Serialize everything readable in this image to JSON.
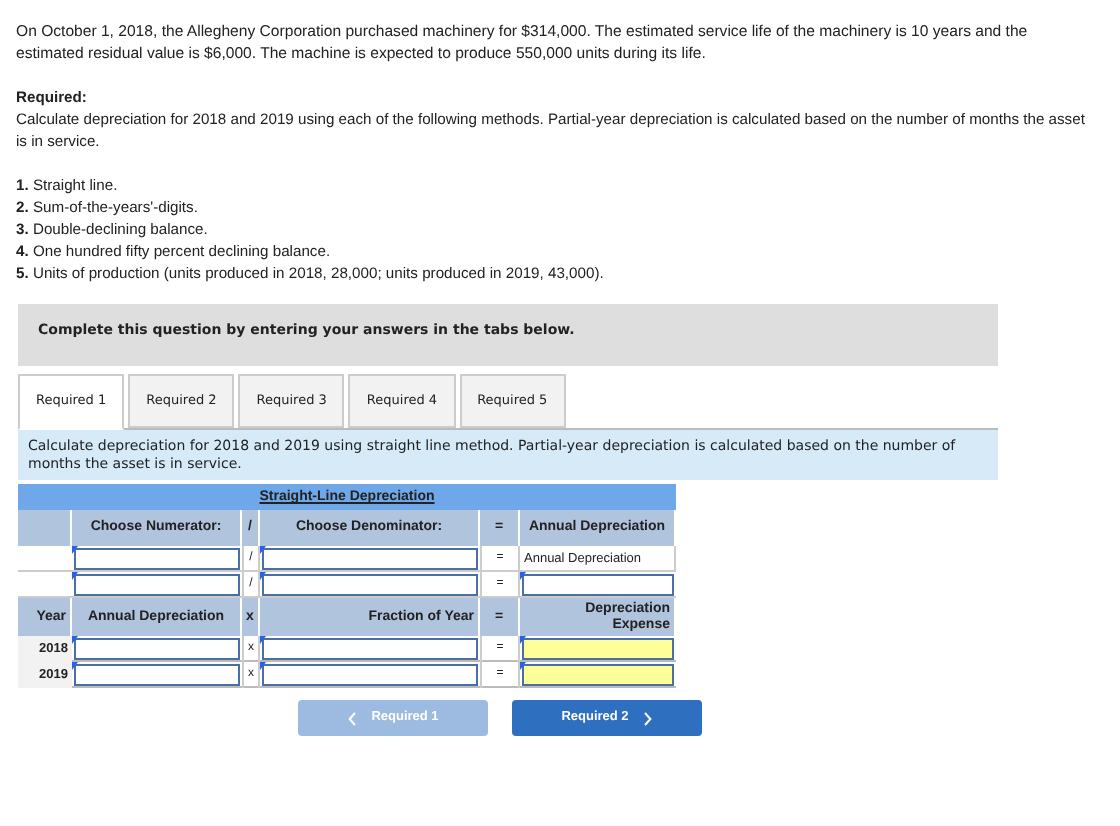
{
  "intro": "On October 1, 2018, the Allegheny Corporation purchased machinery for $314,000. The estimated service life of the machinery is 10 years and the estimated residual value is $6,000. The machine is expected to produce 550,000 units during its life.",
  "required": {
    "heading": "Required:",
    "text": "Calculate depreciation for 2018 and 2019 using each of the following methods. Partial-year depreciation is calculated based on the number of months the asset is in service."
  },
  "methods": [
    {
      "number": "1.",
      "text": "Straight line."
    },
    {
      "number": "2.",
      "text": "Sum-of-the-years'-digits."
    },
    {
      "number": "3.",
      "text": "Double-declining balance."
    },
    {
      "number": "4.",
      "text": "One hundred fifty percent declining balance."
    },
    {
      "number": "5.",
      "text": "Units of production (units produced in 2018, 28,000; units produced in 2019, 43,000)."
    }
  ],
  "instruction": "Complete this question by entering your answers in the tabs below.",
  "tabs": [
    {
      "label": "Required 1",
      "selected": true
    },
    {
      "label": "Required 2",
      "selected": false
    },
    {
      "label": "Required 3",
      "selected": false
    },
    {
      "label": "Required 4",
      "selected": false
    },
    {
      "label": "Required 5",
      "selected": false
    }
  ],
  "tab_instruction": "Calculate depreciation for 2018 and 2019 using straight line method. Partial-year depreciation is calculated based on the number of months the asset is in service.",
  "table": {
    "title": "Straight-Line Depreciation",
    "formula_header": [
      "Choose Numerator:",
      "/",
      "Choose Denominator:",
      "=",
      "Annual Depreciation"
    ],
    "formula_rows": [
      {
        "op1": "/",
        "op2": "=",
        "result": {
          "kind": "text",
          "text": "Annual Depreciation"
        }
      },
      {
        "op1": "/",
        "op2": "=",
        "result": {
          "kind": "input"
        }
      }
    ],
    "expense_header": [
      "Year",
      "Annual Depreciation",
      "x",
      "Fraction of Year",
      "=",
      "Depreciation Expense"
    ],
    "expense_rows": [
      {
        "year": "2018",
        "op1": "x",
        "op2": "="
      },
      {
        "year": "2019",
        "op1": "x",
        "op2": "="
      }
    ]
  },
  "buttons": [
    {
      "label": "Required 1",
      "kind": "prev",
      "disabled": true
    },
    {
      "label": "Required 2",
      "kind": "next",
      "disabled": false
    }
  ]
}
